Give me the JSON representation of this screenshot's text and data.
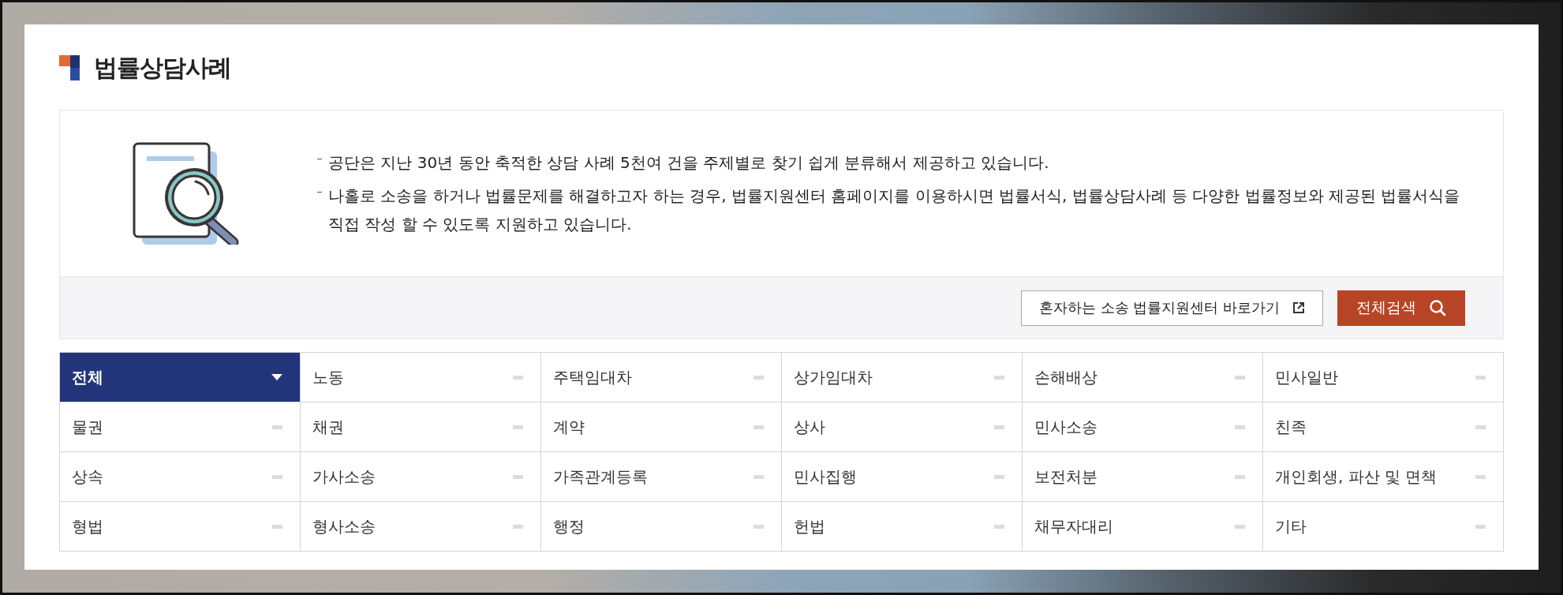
{
  "title": "법률상담사례",
  "intro": [
    "공단은 지난 30년 동안 축적한 상담 사례 5천여 건을 주제별로 찾기 쉽게 분류해서 제공하고 있습니다.",
    "나홀로 소송을 하거나 법률문제를 해결하고자 하는 경우, 법률지원센터 홈페이지를 이용하시면 법률서식, 법률상담사례 등 다양한 법률정보와 제공된 법률서식을 직접 작성 할 수 있도록 지원하고 있습니다."
  ],
  "link_button": "혼자하는 소송 법률지원센터 바로가기",
  "search_button": "전체검색",
  "categories": [
    {
      "label": "전체",
      "selected": true
    },
    {
      "label": "노동",
      "selected": false
    },
    {
      "label": "주택임대차",
      "selected": false
    },
    {
      "label": "상가임대차",
      "selected": false
    },
    {
      "label": "손해배상",
      "selected": false
    },
    {
      "label": "민사일반",
      "selected": false
    },
    {
      "label": "물권",
      "selected": false
    },
    {
      "label": "채권",
      "selected": false
    },
    {
      "label": "계약",
      "selected": false
    },
    {
      "label": "상사",
      "selected": false
    },
    {
      "label": "민사소송",
      "selected": false
    },
    {
      "label": "친족",
      "selected": false
    },
    {
      "label": "상속",
      "selected": false
    },
    {
      "label": "가사소송",
      "selected": false
    },
    {
      "label": "가족관계등록",
      "selected": false
    },
    {
      "label": "민사집행",
      "selected": false
    },
    {
      "label": "보전처분",
      "selected": false
    },
    {
      "label": "개인회생, 파산 및 면책",
      "selected": false
    },
    {
      "label": "형법",
      "selected": false
    },
    {
      "label": "형사소송",
      "selected": false
    },
    {
      "label": "행정",
      "selected": false
    },
    {
      "label": "헌법",
      "selected": false
    },
    {
      "label": "채무자대리",
      "selected": false
    },
    {
      "label": "기타",
      "selected": false
    }
  ]
}
